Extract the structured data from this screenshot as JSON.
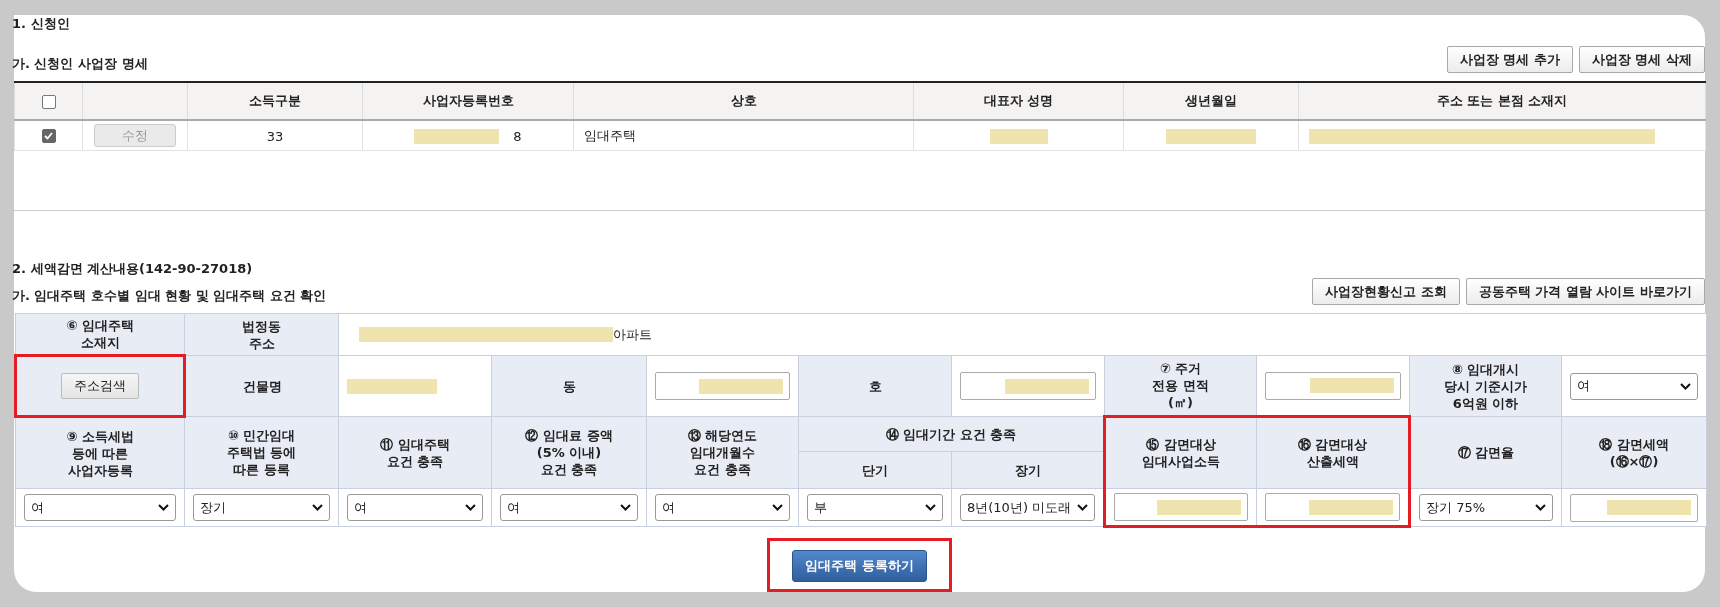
{
  "section1": {
    "title": "1. 신청인",
    "subtitle": "가. 신청인 사업장 명세",
    "buttons": [
      "사업장 명세 추가",
      "사업장 명세 삭제"
    ],
    "table": {
      "header_checked": false,
      "columns": [
        "소득구분",
        "사업자등록번호",
        "상호",
        "대표자 성명",
        "생년월일",
        "주소 또는 본점 소재지"
      ],
      "rows": [
        {
          "checked": true,
          "edit_button": {
            "label": "수정",
            "disabled": true
          },
          "cells": [
            {
              "text": "33",
              "redacted": false
            },
            {
              "text": "8",
              "redacted": true
            },
            {
              "text": "임대주택",
              "redacted": false
            },
            {
              "redacted": true
            },
            {
              "redacted": true
            },
            {
              "redacted": true
            }
          ]
        }
      ]
    }
  },
  "section2": {
    "title": "2. 세액감면 계산내용(142-90-27018)",
    "subtitle": "가. 임대주택 호수별 임대 현황 및 임대주택 요건 확인",
    "buttons": [
      "사업장현황신고 조회",
      "공동주택 가격 열람 사이트 바로가기"
    ],
    "address_row": {
      "label": "⑥ 임대주택\n소재지",
      "sub_label": "법정동\n주소",
      "redacted": true,
      "suffix": "아파트"
    },
    "building_row": {
      "search_button": {
        "label": "주소검색",
        "highlighted": true
      },
      "fields": [
        {
          "label": "건물명",
          "kind": "text",
          "redacted": true
        },
        {
          "label": "동",
          "kind": "input",
          "redacted": true
        },
        {
          "label": "호",
          "kind": "input",
          "redacted": true
        },
        {
          "label": "⑦ 주거\n전용 면적\n(㎡)",
          "kind": "input",
          "redacted": true
        },
        {
          "label": "⑧ 임대개시\n당시 기준시가\n6억원 이하",
          "kind": "select",
          "value": "여"
        }
      ]
    },
    "requirements": [
      {
        "label": "⑨ 소득세법\n등에 따른\n사업자등록",
        "kind": "select",
        "value": "여",
        "highlighted": false
      },
      {
        "label": "⑩ 민간임대\n주택법 등에\n따른 등록",
        "kind": "select",
        "value": "장기",
        "highlighted": false
      },
      {
        "label": "⑪ 임대주택\n요건 충족",
        "kind": "select",
        "value": "여",
        "highlighted": false
      },
      {
        "label": "⑫ 임대료 증액\n(5% 이내)\n요건 충족",
        "kind": "select",
        "value": "여",
        "highlighted": false
      },
      {
        "label": "⑬ 해당연도\n임대개월수\n요건 충족",
        "kind": "select",
        "value": "여",
        "highlighted": false
      },
      {
        "label": "⑭ 임대기간 요건 충족",
        "kind": "group",
        "highlighted": false,
        "children": [
          {
            "label": "단기",
            "kind": "select",
            "value": "부"
          },
          {
            "label": "장기",
            "kind": "select",
            "value": "8년(10년) 미도래"
          }
        ]
      },
      {
        "label": "⑮ 감면대상\n임대사업소득",
        "kind": "input",
        "redacted": true,
        "highlighted": true
      },
      {
        "label": "⑯ 감면대상\n산출세액",
        "kind": "input",
        "redacted": true,
        "highlighted": true
      },
      {
        "label": "⑰ 감면율",
        "kind": "select",
        "value": "장기 75%",
        "highlighted": false
      },
      {
        "label": "⑱ 감면세액\n(⑯×⑰)",
        "kind": "input",
        "redacted": true,
        "highlighted": false
      }
    ],
    "register_button": {
      "label": "임대주택 등록하기",
      "highlighted": true
    }
  }
}
